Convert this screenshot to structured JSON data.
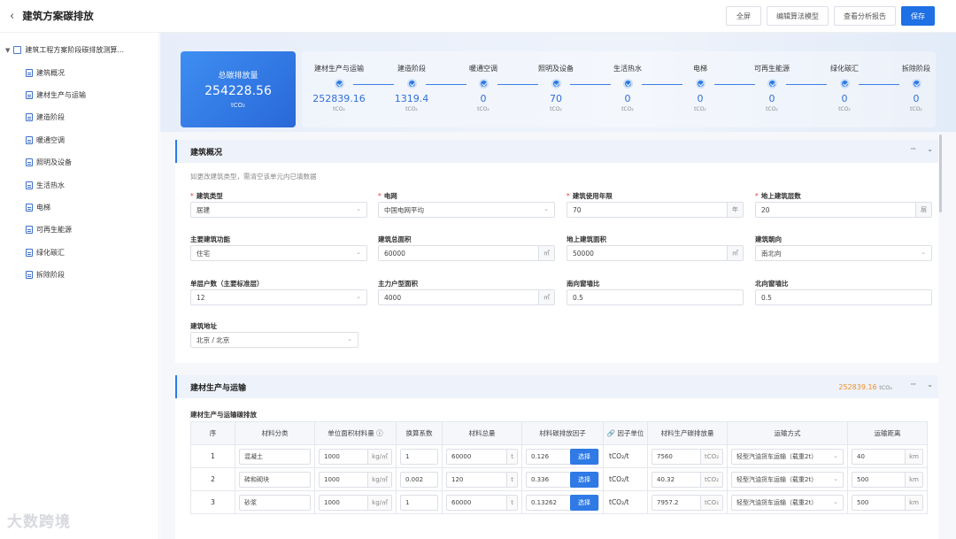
{
  "app": {
    "title": "建筑方案碳排放",
    "back_icon": "‹",
    "buttons": [
      "全屏",
      "编辑算法模型",
      "查看分析报告",
      "保存"
    ]
  },
  "sidebar": {
    "root": "建筑工程方案阶段碳排放测算...",
    "items": [
      "建筑概况",
      "建材生产与运输",
      "建造阶段",
      "暖通空调",
      "照明及设备",
      "生活热水",
      "电梯",
      "可再生能源",
      "绿化碳汇",
      "拆除阶段"
    ]
  },
  "summary": {
    "total_label": "总碳排放量",
    "total_value": "254228.56",
    "total_unit": "tCO₂",
    "stages": [
      {
        "name": "建材生产与运输",
        "value": "252839.16",
        "unit": "tCO₂"
      },
      {
        "name": "建造阶段",
        "value": "1319.4",
        "unit": "tCO₂"
      },
      {
        "name": "暖通空调",
        "value": "0",
        "unit": "tCO₂"
      },
      {
        "name": "照明及设备",
        "value": "70",
        "unit": "tCO₂"
      },
      {
        "name": "生活热水",
        "value": "0",
        "unit": "tCO₂"
      },
      {
        "name": "电梯",
        "value": "0",
        "unit": "tCO₂"
      },
      {
        "name": "可再生能源",
        "value": "0",
        "unit": "tCO₂"
      },
      {
        "name": "绿化碳汇",
        "value": "0",
        "unit": "tCO₂"
      },
      {
        "name": "拆除阶段",
        "value": "0",
        "unit": "tCO₂"
      }
    ]
  },
  "overview": {
    "title": "建筑概况",
    "more": "···",
    "hint": "如更改建筑类型，需清空该单元内已填数据",
    "fields": [
      {
        "label": "建筑类型",
        "required": "*",
        "value": "居建"
      },
      {
        "label": "电网",
        "required": "*",
        "value": "中国电网平均"
      },
      {
        "label": "建筑使用年限",
        "required": "*",
        "value": "70",
        "unit": "年"
      },
      {
        "label": "地上建筑层数",
        "required": "*",
        "value": "20",
        "unit": "层"
      },
      {
        "label": "主要建筑功能",
        "value": "住宅"
      },
      {
        "label": "建筑总面积",
        "value": "60000",
        "unit": "㎡"
      },
      {
        "label": "地上建筑面积",
        "value": "50000",
        "unit": "㎡"
      },
      {
        "label": "建筑朝向",
        "value": "南北向"
      },
      {
        "label": "单层户数（主要标准层）",
        "value": "12"
      },
      {
        "label": "主力户型面积",
        "value": "4000",
        "unit": "㎡"
      },
      {
        "label": "南向窗墙比",
        "value": "0.5"
      },
      {
        "label": "北向窗墙比",
        "value": "0.5"
      },
      {
        "label": "建筑地址",
        "value": "北京 / 北京"
      }
    ]
  },
  "materials": {
    "title": "建材生产与运输",
    "total_value": "252839.16",
    "total_unit": "tCO₂",
    "more": "···",
    "table_title": "建材生产与运输碳排放",
    "columns": [
      "序",
      "材料分类",
      "单位面积材料量 ⓘ",
      "换算系数",
      "材料总量",
      "材料碳排放因子",
      "🔗 因子单位",
      "材料生产碳排放量",
      "运输方式",
      "运输距离"
    ],
    "select_label": "选择",
    "rows": [
      {
        "no": "1",
        "category": "混凝土",
        "per_area": "1000",
        "per_area_unit": "kg/㎡",
        "coef": "1",
        "total": "60000",
        "total_unit": "t",
        "factor": "0.126",
        "factor_unit": "tCO₂/t",
        "emission": "7560",
        "emission_unit": "tCO₂",
        "transport": "轻型汽油货车运输（载重2t）",
        "distance": "40",
        "distance_unit": "km"
      },
      {
        "no": "2",
        "category": "砖和砌块",
        "per_area": "1000",
        "per_area_unit": "kg/㎡",
        "coef": "0.002",
        "total": "120",
        "total_unit": "t",
        "factor": "0.336",
        "factor_unit": "tCO₂/t",
        "emission": "40.32",
        "emission_unit": "tCO₂",
        "transport": "轻型汽油货车运输（载重2t）",
        "distance": "500",
        "distance_unit": "km"
      },
      {
        "no": "3",
        "category": "砂浆",
        "per_area": "1000",
        "per_area_unit": "kg/㎡",
        "coef": "1",
        "total": "60000",
        "total_unit": "t",
        "factor": "0.13262",
        "factor_unit": "tCO₂/t",
        "emission": "7957.2",
        "emission_unit": "tCO₂",
        "transport": "轻型汽油货车运输（载重2t）",
        "distance": "500",
        "distance_unit": "km"
      }
    ]
  },
  "watermark": "大数跨境",
  "colors": {
    "accent": "#2f7ae5",
    "total_orange": "#f0902a",
    "required": "#e63b3b"
  }
}
